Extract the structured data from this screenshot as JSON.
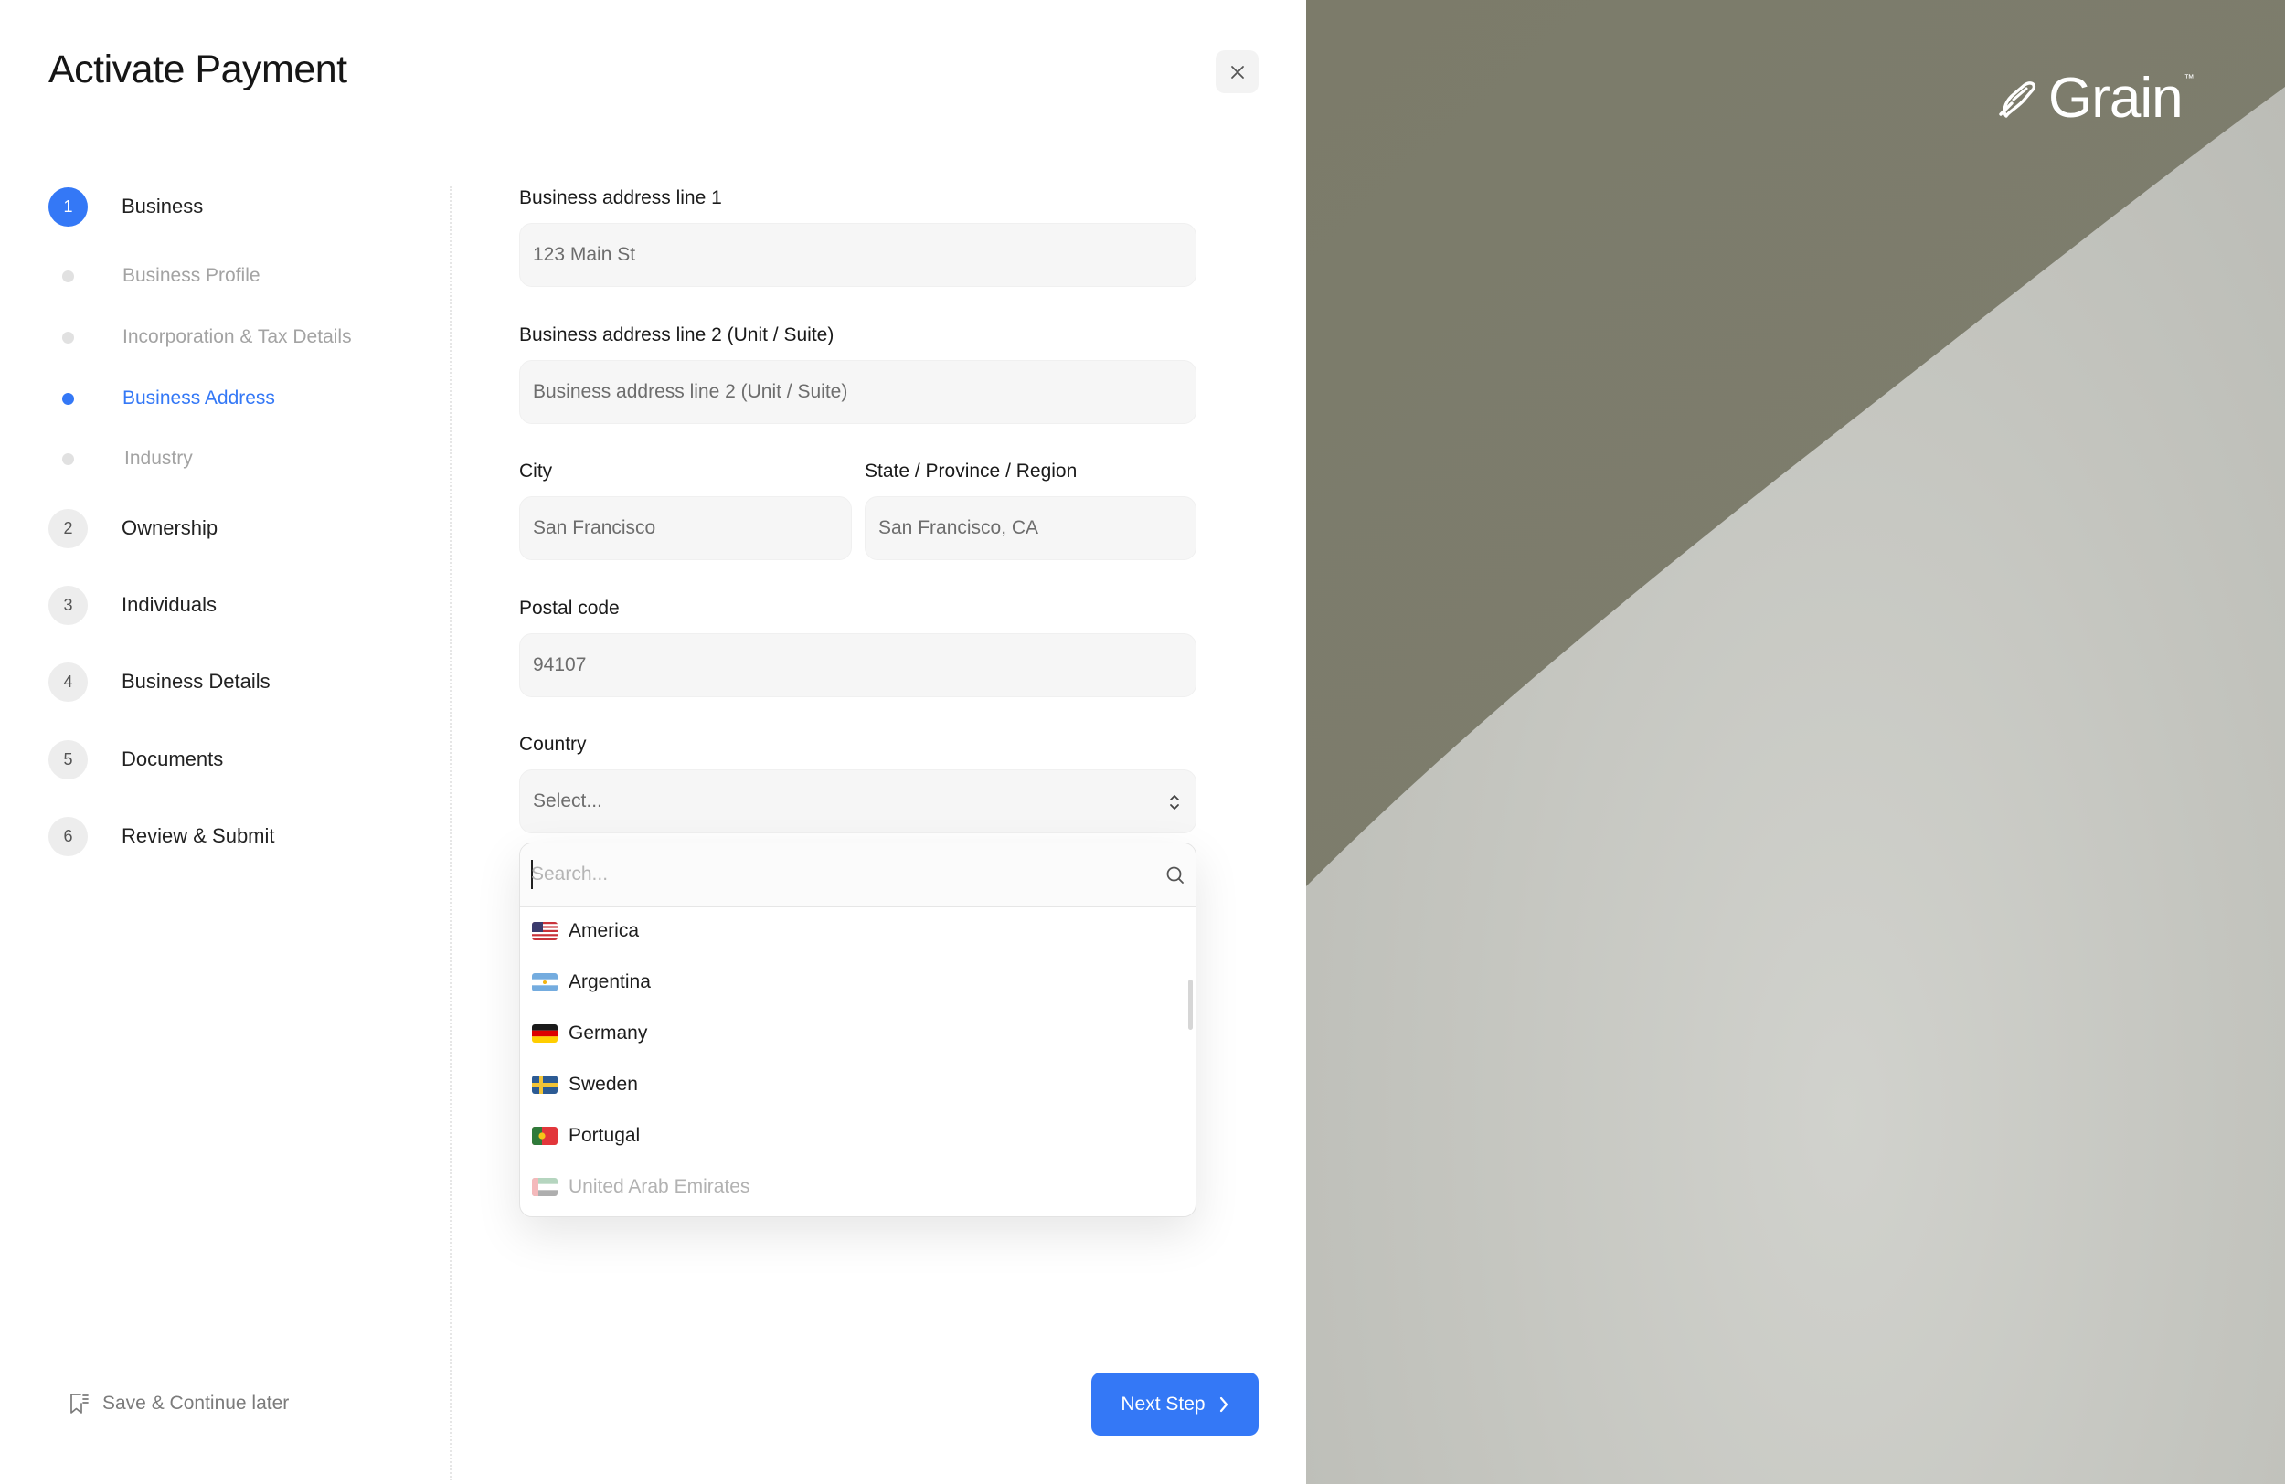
{
  "header": {
    "title": "Activate Payment",
    "close_icon": "close-icon"
  },
  "stepper": {
    "steps": [
      {
        "number": "1",
        "label": "Business",
        "active": true
      },
      {
        "number": "2",
        "label": "Ownership"
      },
      {
        "number": "3",
        "label": "Individuals"
      },
      {
        "number": "4",
        "label": "Business Details"
      },
      {
        "number": "5",
        "label": "Documents"
      },
      {
        "number": "6",
        "label": "Review & Submit"
      }
    ],
    "substeps": [
      {
        "label": "Business Profile"
      },
      {
        "label": "Incorporation & Tax Details"
      },
      {
        "label": "Business Address",
        "active": true
      },
      {
        "label": "Industry"
      }
    ]
  },
  "form": {
    "address1": {
      "label": "Business address line 1",
      "value": "123 Main St"
    },
    "address2": {
      "label": "Business address line 2 (Unit / Suite)",
      "placeholder": "Business address line 2 (Unit / Suite)"
    },
    "city": {
      "label": "City",
      "value": "San Francisco"
    },
    "state": {
      "label": "State / Province / Region",
      "value": "San Francisco, CA"
    },
    "postal": {
      "label": "Postal code",
      "value": "94107"
    },
    "country": {
      "label": "Country",
      "placeholder": "Select..."
    }
  },
  "dropdown": {
    "search_placeholder": "Search...",
    "options": [
      {
        "label": "America",
        "flag": "us-flag"
      },
      {
        "label": "Argentina",
        "flag": "ar-flag"
      },
      {
        "label": "Germany",
        "flag": "de-flag"
      },
      {
        "label": "Sweden",
        "flag": "se-flag"
      },
      {
        "label": "Portugal",
        "flag": "pt-flag"
      },
      {
        "label": "United Arab Emirates",
        "flag": "ae-flag"
      }
    ]
  },
  "footer": {
    "save_later_label": "Save & Continue later",
    "next_label": "Next Step"
  },
  "brand": {
    "logo_text": "Grain",
    "trademark": "™"
  },
  "colors": {
    "accent": "#3478f6",
    "muted": "#a3a3a3"
  }
}
